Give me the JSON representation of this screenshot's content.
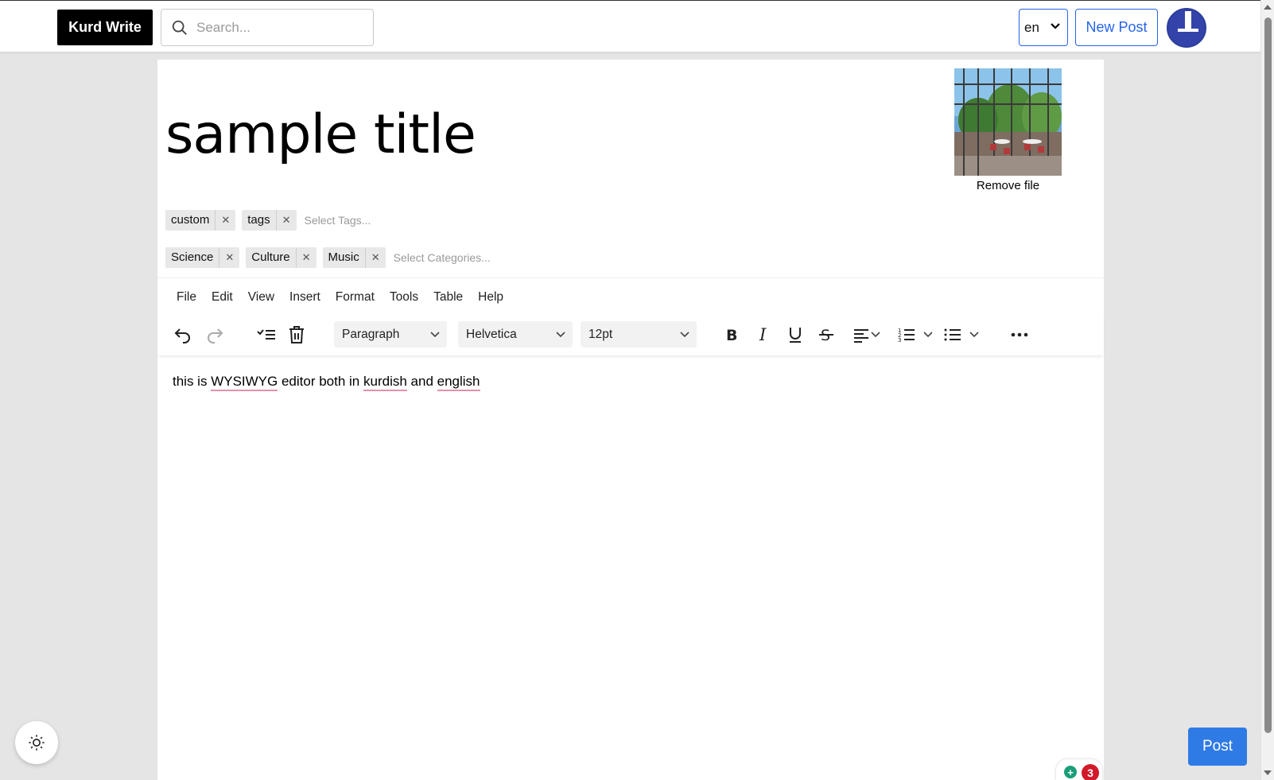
{
  "header": {
    "brand": "Kurd Write",
    "search_placeholder": "Search...",
    "language": "en",
    "new_post_label": "New Post"
  },
  "post": {
    "title": "sample title",
    "remove_file_label": "Remove file",
    "tags": [
      "custom",
      "tags"
    ],
    "tags_placeholder": "Select Tags...",
    "categories": [
      "Science",
      "Culture",
      "Music"
    ],
    "categories_placeholder": "Select Categories..."
  },
  "editor": {
    "menu": [
      "File",
      "Edit",
      "View",
      "Insert",
      "Format",
      "Tools",
      "Table",
      "Help"
    ],
    "block_format": "Paragraph",
    "font_family": "Helvetica",
    "font_size": "12pt",
    "content_parts": [
      "this is ",
      "WYSIWYG",
      " editor both in ",
      "kurdish",
      " and ",
      "english"
    ],
    "notification_count": "3"
  },
  "footer": {
    "post_button_label": "Post"
  },
  "colors": {
    "accent": "#2563eb",
    "post_button": "#2f7be5",
    "brand_bg": "#000000",
    "spellcheck_underline": "#e58fae"
  },
  "icons": [
    "search-icon",
    "chevron-down-icon",
    "undo-icon",
    "redo-icon",
    "select-all-icon",
    "trash-icon",
    "bold-icon",
    "italic-icon",
    "underline-icon",
    "strikethrough-icon",
    "align-left-icon",
    "numbered-list-icon",
    "bullet-list-icon",
    "more-icon",
    "sun-icon"
  ]
}
